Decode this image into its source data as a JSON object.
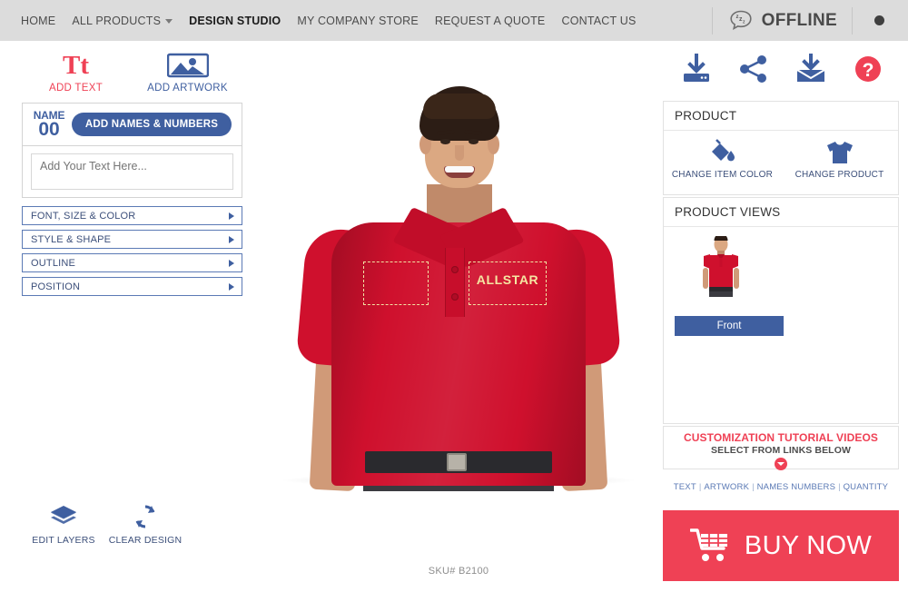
{
  "topnav": {
    "links": [
      {
        "label": "HOME",
        "active": false,
        "caret": false
      },
      {
        "label": "ALL PRODUCTS",
        "active": false,
        "caret": true
      },
      {
        "label": "DESIGN STUDIO",
        "active": true,
        "caret": false
      },
      {
        "label": "MY COMPANY STORE",
        "active": false,
        "caret": false
      },
      {
        "label": "REQUEST A QUOTE",
        "active": false,
        "caret": false
      },
      {
        "label": "CONTACT US",
        "active": false,
        "caret": false
      }
    ],
    "chat_status": "OFFLINE",
    "chat_icon": "chat-bubble-zzz-icon",
    "menu_dot": "dot-menu-icon",
    "background_color": "#dcdcdc"
  },
  "left_panel": {
    "add_text": {
      "label": "ADD TEXT",
      "glyph": "Tt",
      "icon": "text-tool-icon",
      "color": "#ef4155"
    },
    "add_artwork": {
      "label": "ADD ARTWORK",
      "icon": "image-artwork-icon",
      "color": "#3f5fa0"
    },
    "names_numbers": {
      "badge_line1": "NAME",
      "badge_line2": "00",
      "button_label": "ADD NAMES & NUMBERS"
    },
    "text_input": {
      "value": "",
      "placeholder": "Add Your Text Here..."
    },
    "accordion": [
      {
        "label": "FONT, SIZE & COLOR",
        "icon": "chevron-right-icon"
      },
      {
        "label": "STYLE & SHAPE",
        "icon": "chevron-right-icon"
      },
      {
        "label": "OUTLINE",
        "icon": "chevron-right-icon"
      },
      {
        "label": "POSITION",
        "icon": "chevron-right-icon"
      }
    ],
    "bottom_tools": [
      {
        "label": "EDIT LAYERS",
        "icon": "layers-icon"
      },
      {
        "label": "CLEAR DESIGN",
        "icon": "refresh-clear-icon"
      }
    ]
  },
  "canvas": {
    "sku": "SKU# B2100",
    "design_text": "ALLSTAR",
    "design_text_color": "#f5e6a2",
    "shirt_color": "#cf102d",
    "selection_boxes": 2
  },
  "right_panel": {
    "actions": [
      {
        "name": "save-design-icon",
        "label": "save"
      },
      {
        "name": "share-design-icon",
        "label": "share"
      },
      {
        "name": "email-design-icon",
        "label": "email"
      },
      {
        "name": "help-icon",
        "label": "?"
      }
    ],
    "product": {
      "title": "PRODUCT",
      "buttons": [
        {
          "label": "CHANGE ITEM COLOR",
          "icon": "paint-bucket-icon"
        },
        {
          "label": "CHANGE PRODUCT",
          "icon": "tshirt-icon"
        }
      ]
    },
    "product_views": {
      "title": "PRODUCT VIEWS",
      "views": [
        {
          "label": "Front",
          "selected": true
        }
      ]
    },
    "tutorial": {
      "title": "CUSTOMIZATION TUTORIAL VIDEOS",
      "subtitle": "SELECT FROM LINKS BELOW",
      "chevron_icon": "chevron-down-circle-icon"
    },
    "tutorial_links": [
      "TEXT",
      "ARTWORK",
      "NAMES NUMBERS",
      "QUANTITY"
    ],
    "link_separator": "|",
    "buy": {
      "label": "BUY NOW",
      "icon": "shopping-cart-icon",
      "color": "#ef4155"
    }
  }
}
